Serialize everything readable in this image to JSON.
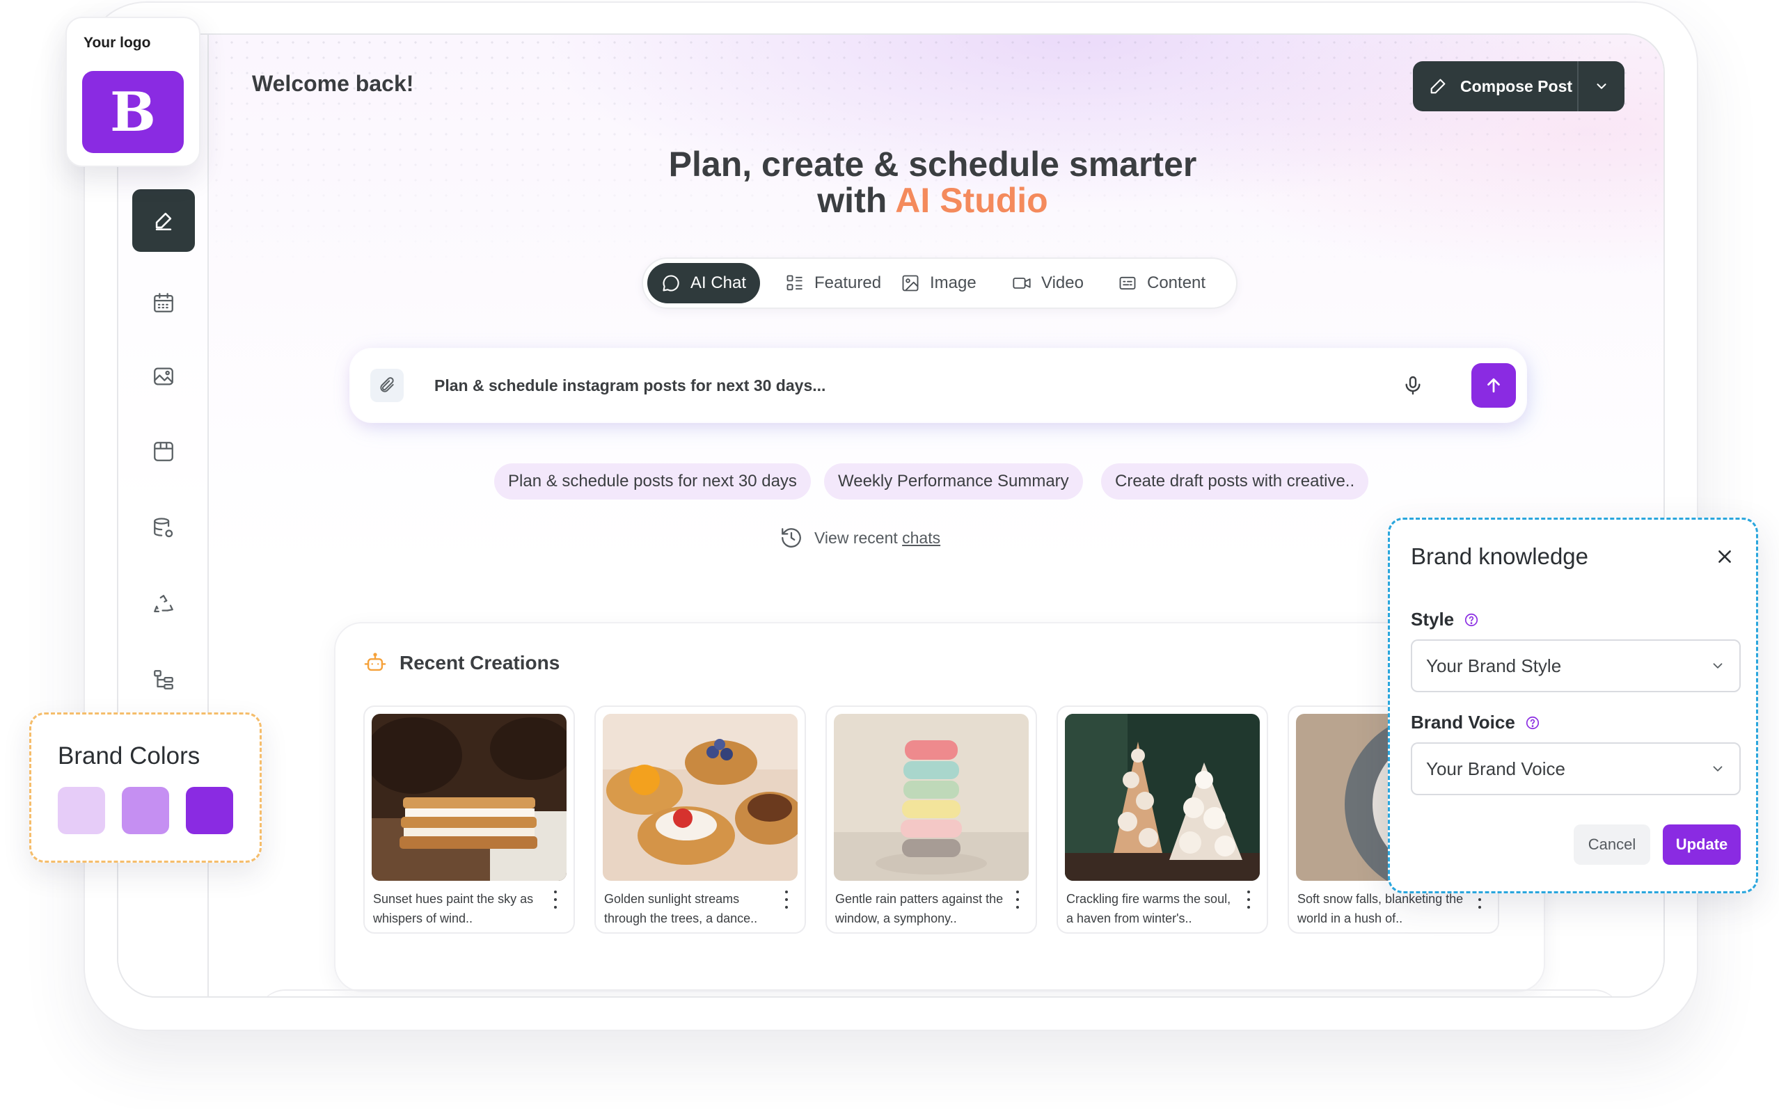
{
  "logo": {
    "label": "Your logo",
    "letter": "B",
    "color": "#8a2be2"
  },
  "header": {
    "welcome": "Welcome back!",
    "compose_label": "Compose Post"
  },
  "hero": {
    "line1": "Plan, create & schedule smarter",
    "line2_prefix": "with ",
    "line2_accent": "AI Studio",
    "accent_color": "#f48a5c"
  },
  "tabs": [
    {
      "label": "AI Chat",
      "icon": "chat-bubble-icon",
      "active": true
    },
    {
      "label": "Featured",
      "icon": "grid-list-icon",
      "active": false
    },
    {
      "label": "Image",
      "icon": "image-icon",
      "active": false
    },
    {
      "label": "Video",
      "icon": "video-camera-icon",
      "active": false
    },
    {
      "label": "Content",
      "icon": "document-text-icon",
      "active": false
    }
  ],
  "prompt": {
    "value": "Plan & schedule instagram posts for next 30 days..."
  },
  "chips": [
    "Plan & schedule posts for next 30 days",
    "Weekly Performance Summary",
    "Create draft posts with creative.."
  ],
  "recent_chats": {
    "prefix": "View recent ",
    "link": "chats"
  },
  "creations": {
    "title": "Recent Creations",
    "cards": [
      {
        "caption": "Sunset hues paint the sky as whispers of wind..",
        "image": "pastry-layered-cake"
      },
      {
        "caption": "Golden sunlight streams through the trees, a dance..",
        "image": "fruit-tarts"
      },
      {
        "caption": "Gentle rain patters against the window, a symphony..",
        "image": "macaron-stack"
      },
      {
        "caption": "Crackling fire warms the soul, a haven from winter's..",
        "image": "cream-puff-tower"
      },
      {
        "caption": "Soft snow falls, blanketing the world in a hush of..",
        "image": "plated-dessert"
      }
    ]
  },
  "brand_colors": {
    "title": "Brand Colors",
    "swatches": [
      "#e6ccf8",
      "#c58ff2",
      "#8a2be2"
    ]
  },
  "brand_knowledge": {
    "title": "Brand knowledge",
    "style_label": "Style",
    "style_value": "Your Brand Style",
    "voice_label": "Brand Voice",
    "voice_value": "Your Brand Voice",
    "cancel": "Cancel",
    "update": "Update"
  },
  "sidebar_icons": [
    "edit-icon",
    "calendar-icon",
    "media-library-icon",
    "store-icon",
    "database-settings-icon",
    "recycle-icon",
    "hierarchy-icon"
  ]
}
